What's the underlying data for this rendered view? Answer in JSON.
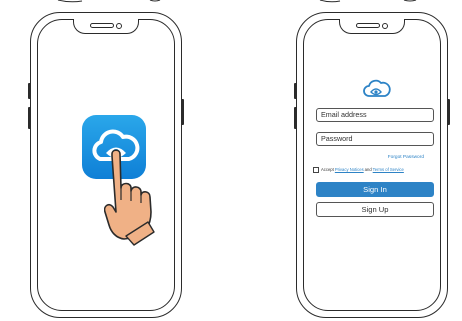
{
  "colors": {
    "app_blue": "#1a90df",
    "link_blue": "#2d83c6",
    "skin": "#f0b186",
    "outline": "#2b2b2b"
  },
  "left_phone": {
    "icons": [
      "cloud-eye-app-icon",
      "pointing-hand-icon"
    ]
  },
  "right_phone": {
    "logo_icon": "cloud-eye-logo-icon",
    "email_placeholder": "Email address",
    "password_placeholder": "Password",
    "forgot_password": "Forgot Password",
    "accept_prefix": "Accept",
    "privacy_link": "Privacy Notices",
    "and_text": "and",
    "terms_link": "Terms of Service",
    "sign_in": "Sign In",
    "sign_up": "Sign Up"
  }
}
